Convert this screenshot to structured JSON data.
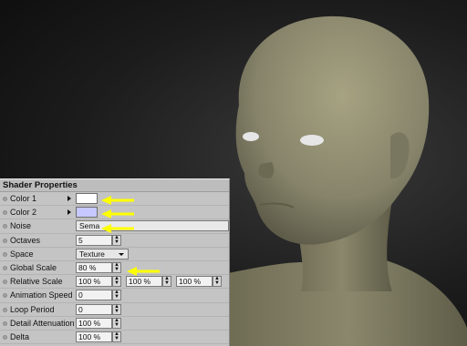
{
  "panel": {
    "title": "Shader Properties",
    "rows": [
      {
        "label": "Color 1",
        "kind": "color",
        "color": "#ffffff"
      },
      {
        "label": "Color 2",
        "kind": "color",
        "color": "#c6c8ff"
      },
      {
        "label": "Noise",
        "kind": "noise",
        "value": "Sema"
      },
      {
        "label": "Octaves",
        "kind": "number",
        "value": "5"
      },
      {
        "label": "Space",
        "kind": "dropdown",
        "value": "Texture"
      },
      {
        "label": "Global Scale",
        "kind": "number",
        "value": "80 %"
      },
      {
        "label": "Relative Scale",
        "kind": "triple",
        "values": [
          "100 %",
          "100 %",
          "100 %"
        ]
      },
      {
        "label": "Animation Speed",
        "kind": "number",
        "value": "0"
      },
      {
        "label": "Loop Period",
        "kind": "number",
        "value": "0"
      },
      {
        "label": "Detail Attenuation",
        "kind": "number",
        "value": "100 %"
      },
      {
        "label": "Delta",
        "kind": "number",
        "value": "100 %"
      }
    ]
  },
  "colors": {
    "arrow": "#ffff00",
    "skin": "#8f8c6c",
    "panel_bg": "#c4c4c4"
  },
  "icons": {
    "row_dot": "circle-dot-icon",
    "expand": "triangle-right-icon",
    "spinner": "up-down-arrows-icon",
    "dropdown": "caret-down-icon",
    "annotation": "yellow-arrow-icon"
  }
}
